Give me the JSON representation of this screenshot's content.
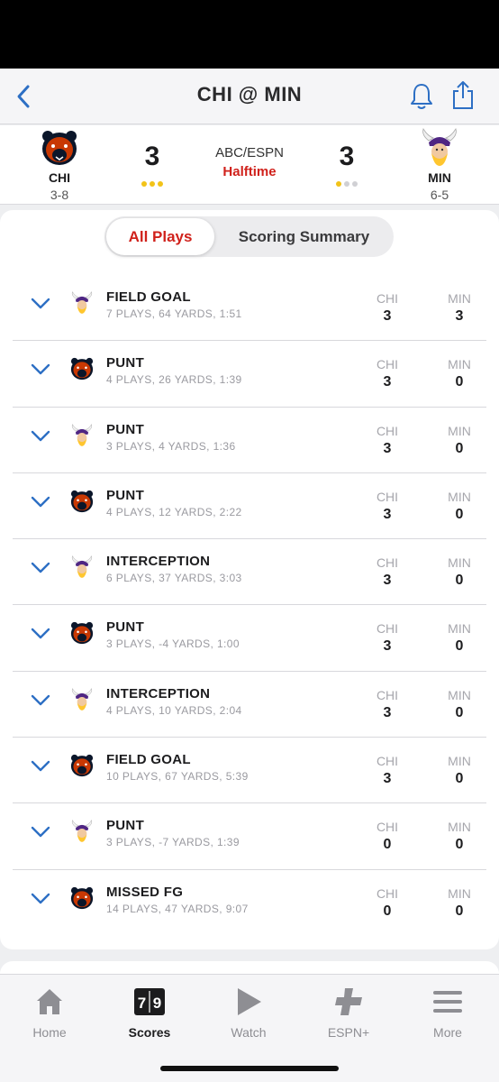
{
  "nav": {
    "title": "CHI @ MIN",
    "back_icon": "chevron-left-icon",
    "bell_icon": "bell-icon",
    "share_icon": "share-icon"
  },
  "game": {
    "away": {
      "abbr": "CHI",
      "record": "3-8",
      "score": "3",
      "timeouts_remaining": 3
    },
    "home": {
      "abbr": "MIN",
      "record": "6-5",
      "score": "3",
      "timeouts_remaining": 1
    },
    "broadcast": "ABC/ESPN",
    "status": "Halftime",
    "colors": {
      "accent": "#d0211b",
      "timeout": "#f2c318",
      "link": "#2d6fc4"
    }
  },
  "segments": {
    "active": "All Plays",
    "inactive": "Scoring Summary"
  },
  "columns": {
    "chi": "CHI",
    "min": "MIN"
  },
  "drives": [
    {
      "team": "min",
      "title": "FIELD GOAL",
      "summary": "7 PLAYS, 64 YARDS, 1:51",
      "chi": "3",
      "min": "3"
    },
    {
      "team": "chi",
      "title": "PUNT",
      "summary": "4 PLAYS, 26 YARDS, 1:39",
      "chi": "3",
      "min": "0"
    },
    {
      "team": "min",
      "title": "PUNT",
      "summary": "3 PLAYS, 4 YARDS, 1:36",
      "chi": "3",
      "min": "0"
    },
    {
      "team": "chi",
      "title": "PUNT",
      "summary": "4 PLAYS, 12 YARDS, 2:22",
      "chi": "3",
      "min": "0"
    },
    {
      "team": "min",
      "title": "INTERCEPTION",
      "summary": "6 PLAYS, 37 YARDS, 3:03",
      "chi": "3",
      "min": "0"
    },
    {
      "team": "chi",
      "title": "PUNT",
      "summary": "3 PLAYS, -4 YARDS, 1:00",
      "chi": "3",
      "min": "0"
    },
    {
      "team": "min",
      "title": "INTERCEPTION",
      "summary": "4 PLAYS, 10 YARDS, 2:04",
      "chi": "3",
      "min": "0"
    },
    {
      "team": "chi",
      "title": "FIELD GOAL",
      "summary": "10 PLAYS, 67 YARDS, 5:39",
      "chi": "3",
      "min": "0"
    },
    {
      "team": "min",
      "title": "PUNT",
      "summary": "3 PLAYS, -7 YARDS, 1:39",
      "chi": "0",
      "min": "0"
    },
    {
      "team": "chi",
      "title": "MISSED FG",
      "summary": "14 PLAYS, 47 YARDS, 9:07",
      "chi": "0",
      "min": "0"
    }
  ],
  "tabbar": [
    {
      "label": "Home",
      "icon": "home-icon",
      "active": false
    },
    {
      "label": "Scores",
      "icon": "scoreboard-icon",
      "active": true
    },
    {
      "label": "Watch",
      "icon": "play-icon",
      "active": false
    },
    {
      "label": "ESPN+",
      "icon": "plus-icon",
      "active": false
    },
    {
      "label": "More",
      "icon": "menu-icon",
      "active": false
    }
  ]
}
